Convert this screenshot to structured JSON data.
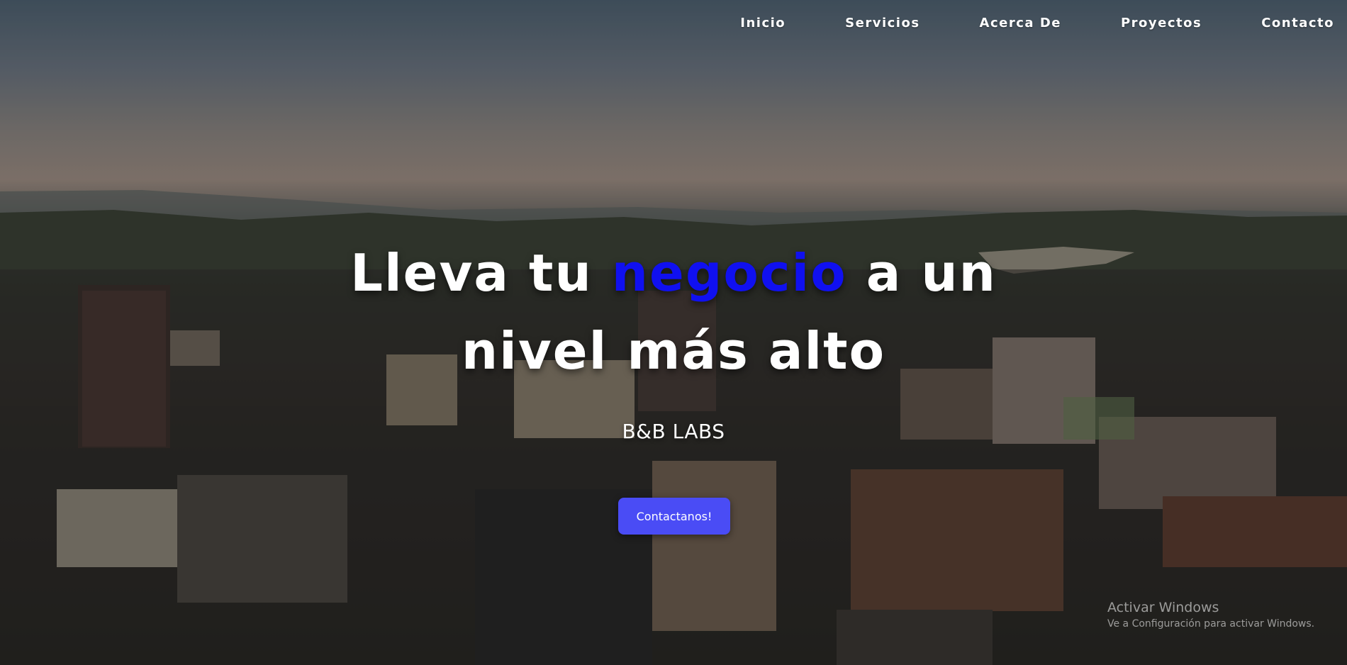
{
  "nav": {
    "items": [
      {
        "label": "Inicio"
      },
      {
        "label": "Servicios"
      },
      {
        "label": "Acerca De"
      },
      {
        "label": "Proyectos"
      },
      {
        "label": "Contacto"
      }
    ]
  },
  "hero": {
    "headline_part1": "Lleva tu ",
    "headline_accent": "negocio",
    "headline_part2": " a un",
    "headline_line2": "nivel más alto",
    "brand": "B&B LABS",
    "cta_label": "Contactanos!",
    "background": "aerial-city-photo"
  },
  "watermark": {
    "title": "Activar Windows",
    "subtitle": "Ve a Configuración para activar Windows."
  },
  "colors": {
    "accent": "#1010f0",
    "button": "#4a4cf5",
    "text": "#ffffff"
  }
}
